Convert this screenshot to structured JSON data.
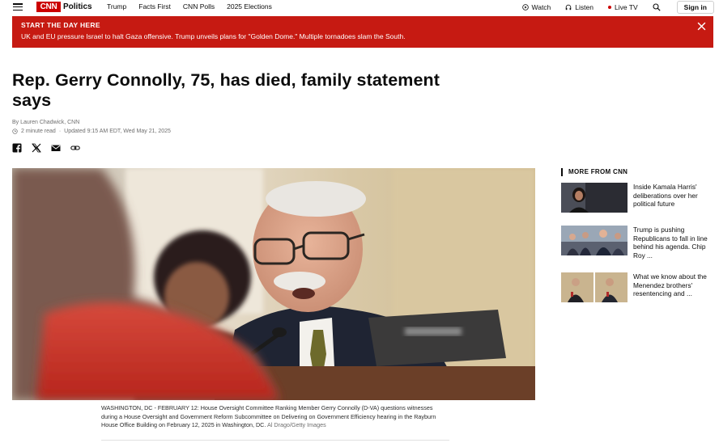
{
  "nav": {
    "section": "Politics",
    "logo": "CNN",
    "links": [
      "Trump",
      "Facts First",
      "CNN Polls",
      "2025 Elections"
    ],
    "watch": "Watch",
    "listen": "Listen",
    "live": "Live TV",
    "signin": "Sign in"
  },
  "banner": {
    "kicker": "START THE DAY HERE",
    "text": "UK and EU pressure Israel to halt Gaza offensive. Trump unveils plans for \"Golden Dome.\" Multiple tornadoes slam the South."
  },
  "article": {
    "headline": "Rep. Gerry Connolly, 75, has died, family statement says",
    "byline": "By Lauren Chadwick, CNN",
    "read_time": "2 minute read",
    "updated": "Updated 9:15 AM EDT, Wed May 21, 2025",
    "caption": "WASHINGTON, DC - FEBRUARY 12: House Oversight Committee Ranking Member Gerry Connolly (D-VA) questions witnesses during a House Oversight and Government Reform Subcommittee on Delivering on Government Efficiency hearing in the Rayburn House Office Building on February 12, 2025 in Washington, DC.",
    "credit": "Al Drago/Getty Images"
  },
  "more": {
    "heading": "MORE FROM CNN",
    "items": [
      {
        "title": "Inside Kamala Harris' deliberations over her political future"
      },
      {
        "title": "Trump is pushing Republicans to fall in line behind his agenda. Chip Roy ..."
      },
      {
        "title": "What we know about the Menendez brothers' resentencing and ..."
      }
    ]
  },
  "colors": {
    "brand_red": "#cc0000",
    "banner_red": "#c61a12"
  }
}
